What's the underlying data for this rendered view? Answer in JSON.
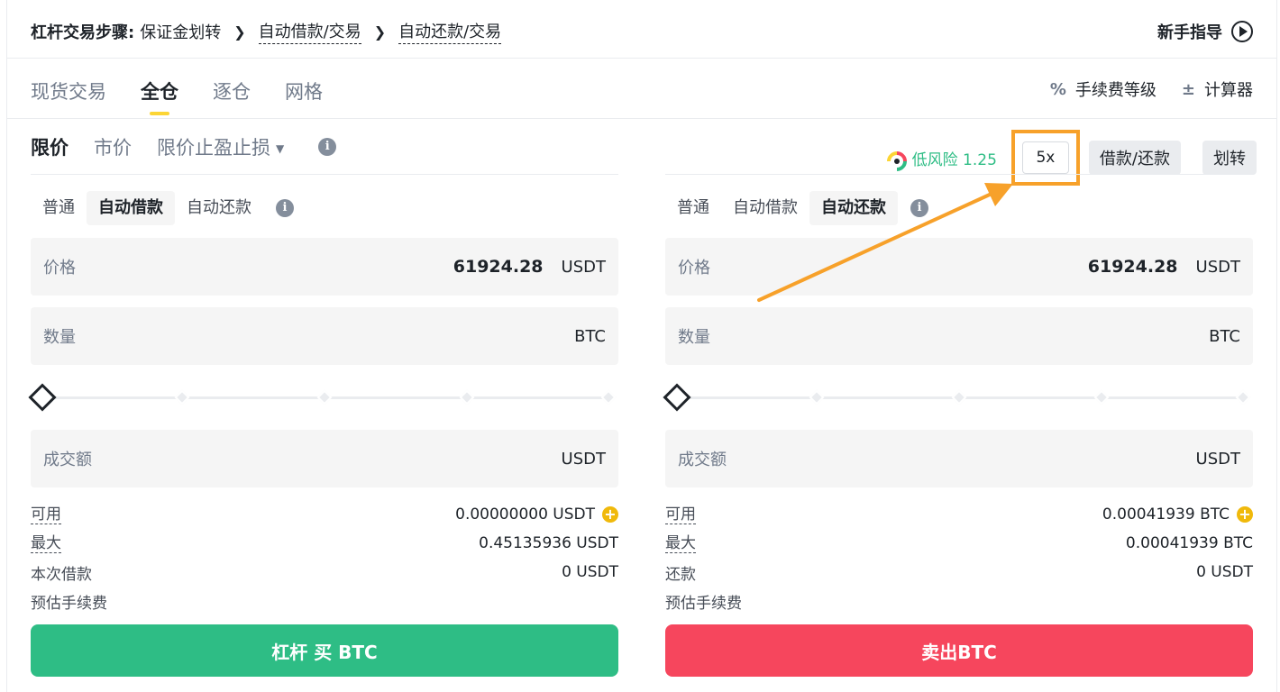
{
  "header": {
    "steps_label": "杠杆交易步骤:",
    "step1": "保证金划转",
    "step2": "自动借款/交易",
    "step3": "自动还款/交易",
    "guide_label": "新手指导"
  },
  "mode_tabs": [
    "现货交易",
    "全仓",
    "逐仓",
    "网格"
  ],
  "tools": {
    "fee_level": "手续费等级",
    "calculator": "计算器"
  },
  "order_types": [
    "限价",
    "市价",
    "限价止盈止损"
  ],
  "controls": {
    "risk_text": "低风险 1.25",
    "leverage": "5x",
    "borrow_repay": "借款/还款",
    "transfer": "划转"
  },
  "left_panel": {
    "subtabs": [
      "普通",
      "自动借款",
      "自动还款"
    ],
    "price_label": "价格",
    "price_value": "61924.28",
    "price_unit": "USDT",
    "amount_label": "数量",
    "amount_unit": "BTC",
    "total_label": "成交额",
    "total_unit": "USDT",
    "available_label": "可用",
    "available_value": "0.00000000 USDT",
    "max_label": "最大",
    "max_value": "0.45135936 USDT",
    "borrow_label": "本次借款",
    "borrow_value": "0 USDT",
    "fee_label": "预估手续费",
    "button": "杠杆 买 BTC"
  },
  "right_panel": {
    "subtabs": [
      "普通",
      "自动借款",
      "自动还款"
    ],
    "price_label": "价格",
    "price_value": "61924.28",
    "price_unit": "USDT",
    "amount_label": "数量",
    "amount_unit": "BTC",
    "total_label": "成交额",
    "total_unit": "USDT",
    "available_label": "可用",
    "available_value": "0.00041939 BTC",
    "max_label": "最大",
    "max_value": "0.00041939 BTC",
    "repay_label": "还款",
    "repay_value": "0 USDT",
    "fee_label": "预估手续费",
    "button": "卖出BTC"
  },
  "colors": {
    "accent_yellow": "#fcd535",
    "buy_green": "#2ebd85",
    "sell_red": "#f6465d",
    "highlight_orange": "#f7a12a"
  }
}
